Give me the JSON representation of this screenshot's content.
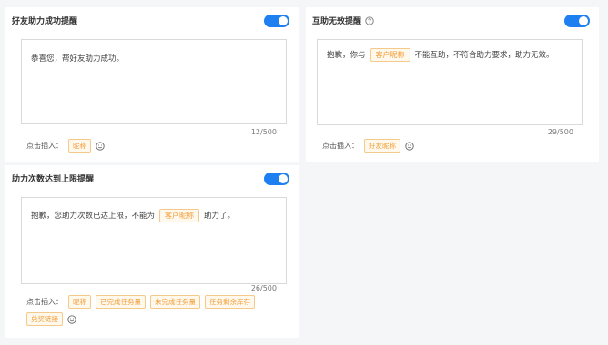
{
  "panels": [
    {
      "title": "好友助力成功提醒",
      "toggle_on": true,
      "content": "恭喜您，帮好友助力成功。",
      "counter": "12/500",
      "insert_label": "点击插入：",
      "insert_tags": [
        "昵称"
      ]
    },
    {
      "title": "互助无效提醒",
      "toggle_on": true,
      "content_before": "抱歉，你与",
      "content_tag": "客户昵称",
      "content_after": "不能互助，不符合助力要求，助力无效。",
      "counter": "29/500",
      "insert_label": "点击插入：",
      "insert_tags": [
        "好友昵称"
      ]
    },
    {
      "title": "助力次数达到上限提醒",
      "toggle_on": true,
      "content_before": "抱歉，您助力次数已达上限，不能为",
      "content_tag": "客户昵称",
      "content_after": "助力了。",
      "counter": "26/500",
      "insert_label": "点击插入：",
      "insert_tags": [
        "昵称",
        "已完成任务量",
        "未完成任务量",
        "任务剩余库存",
        "兑奖链接"
      ]
    }
  ],
  "colors": {
    "toggle": "#1e80f0",
    "tag_text": "#f29d38",
    "tag_border": "#f5c98a",
    "tag_bg": "#fff8ec"
  },
  "icons": {
    "help": "question-circle-icon",
    "emoji": "smile-icon"
  }
}
